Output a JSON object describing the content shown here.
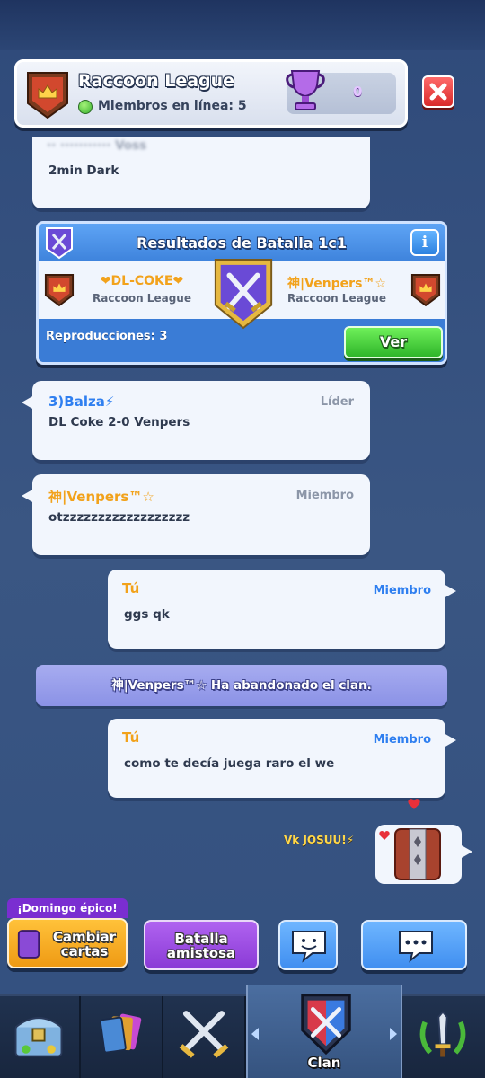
{
  "header": {
    "clan_name": "Raccoon League",
    "members_online": "Miembros en línea: 5",
    "trophies": "0"
  },
  "partial_message": {
    "author": "·· ··········· Voss",
    "text": "2min Dark"
  },
  "battle": {
    "title": "Resultados de Batalla 1c1",
    "info_label": "i",
    "player1": "❤DL-COKE❤",
    "player1_clan": "Raccoon League",
    "player2": "神|Venpers™☆",
    "player2_clan": "Raccoon League",
    "replays": "Reproducciones: 3",
    "view_label": "Ver"
  },
  "messages": [
    {
      "author": "3)Balza⚡",
      "role": "Líder",
      "text": "DL Coke 2-0 Venpers"
    },
    {
      "author": "神|Venpers™☆",
      "role": "Miembro",
      "text": "otzzzzzzzzzzzzzzzzzz"
    },
    {
      "author": "Tú",
      "role": "Miembro",
      "text": "ggs qk"
    },
    {
      "author": "Tú",
      "role": "Miembro",
      "text": "como te decía juega raro el we"
    }
  ],
  "system_message": "神|Venpers™☆ Ha abandonado el clan.",
  "emote": {
    "sender": "Vk JOSUU!⚡"
  },
  "actions": {
    "promo_tag": "¡Domingo épico!",
    "trade_cards": "Cambiar cartas",
    "friendly_battle": "Batalla amistosa"
  },
  "nav": {
    "active_label": "Clan"
  },
  "colors": {
    "author_orange": "#f2a21b",
    "author_blue": "#2f7ff0",
    "role_gray": "#8c96a8",
    "role_blue": "#2f7ff0",
    "green_button": "#3fc234",
    "purple_button": "#8a3ad6",
    "orange_button": "#f3a51b",
    "blue_button": "#3f94f0"
  }
}
